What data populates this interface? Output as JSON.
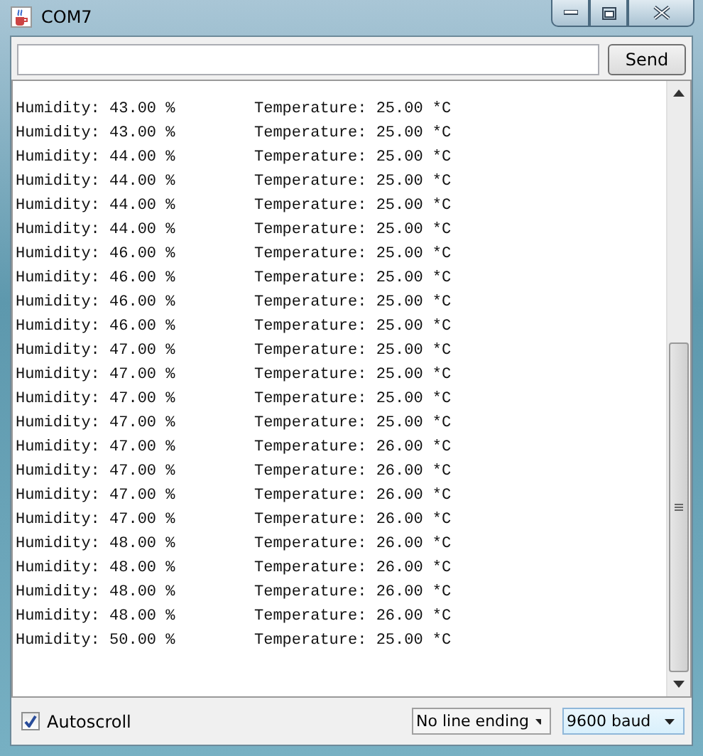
{
  "window": {
    "title": "COM7"
  },
  "send_button": "Send",
  "lines": [
    {
      "humidity": "Humidity: 43.00 %",
      "temperature": "Temperature: 25.00 *C"
    },
    {
      "humidity": "Humidity: 43.00 %",
      "temperature": "Temperature: 25.00 *C"
    },
    {
      "humidity": "Humidity: 44.00 %",
      "temperature": "Temperature: 25.00 *C"
    },
    {
      "humidity": "Humidity: 44.00 %",
      "temperature": "Temperature: 25.00 *C"
    },
    {
      "humidity": "Humidity: 44.00 %",
      "temperature": "Temperature: 25.00 *C"
    },
    {
      "humidity": "Humidity: 44.00 %",
      "temperature": "Temperature: 25.00 *C"
    },
    {
      "humidity": "Humidity: 46.00 %",
      "temperature": "Temperature: 25.00 *C"
    },
    {
      "humidity": "Humidity: 46.00 %",
      "temperature": "Temperature: 25.00 *C"
    },
    {
      "humidity": "Humidity: 46.00 %",
      "temperature": "Temperature: 25.00 *C"
    },
    {
      "humidity": "Humidity: 46.00 %",
      "temperature": "Temperature: 25.00 *C"
    },
    {
      "humidity": "Humidity: 47.00 %",
      "temperature": "Temperature: 25.00 *C"
    },
    {
      "humidity": "Humidity: 47.00 %",
      "temperature": "Temperature: 25.00 *C"
    },
    {
      "humidity": "Humidity: 47.00 %",
      "temperature": "Temperature: 25.00 *C"
    },
    {
      "humidity": "Humidity: 47.00 %",
      "temperature": "Temperature: 25.00 *C"
    },
    {
      "humidity": "Humidity: 47.00 %",
      "temperature": "Temperature: 26.00 *C"
    },
    {
      "humidity": "Humidity: 47.00 %",
      "temperature": "Temperature: 26.00 *C"
    },
    {
      "humidity": "Humidity: 47.00 %",
      "temperature": "Temperature: 26.00 *C"
    },
    {
      "humidity": "Humidity: 47.00 %",
      "temperature": "Temperature: 26.00 *C"
    },
    {
      "humidity": "Humidity: 48.00 %",
      "temperature": "Temperature: 26.00 *C"
    },
    {
      "humidity": "Humidity: 48.00 %",
      "temperature": "Temperature: 26.00 *C"
    },
    {
      "humidity": "Humidity: 48.00 %",
      "temperature": "Temperature: 26.00 *C"
    },
    {
      "humidity": "Humidity: 48.00 %",
      "temperature": "Temperature: 26.00 *C"
    },
    {
      "humidity": "Humidity: 50.00 %",
      "temperature": "Temperature: 25.00 *C"
    }
  ],
  "autoscroll": {
    "label": "Autoscroll",
    "checked": true
  },
  "line_ending": "No line ending",
  "baud": "9600 baud"
}
